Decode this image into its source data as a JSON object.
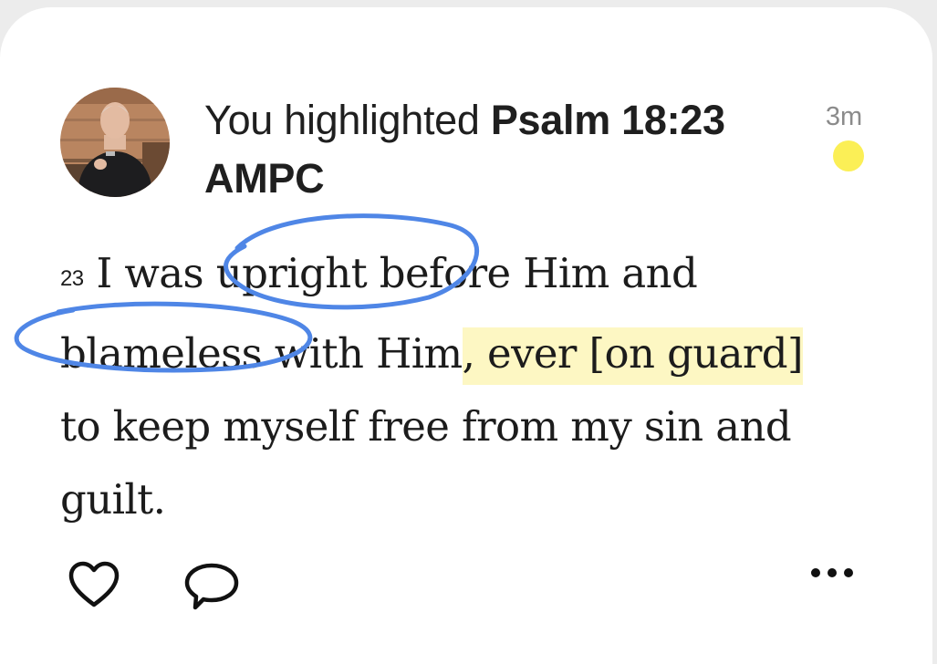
{
  "activity": {
    "prefix": "You highlighted ",
    "reference": "Psalm 18:23 AMPC",
    "time": "3m"
  },
  "avatar": {
    "description_icon": "user-photo-avatar"
  },
  "verse": {
    "number": "23",
    "text_before_highlight": "I was upright before Him and blameless with Him",
    "highlighted_text": ", ever [on guard]",
    "text_after_highlight": " to keep myself free from my sin and guilt."
  },
  "annotations": {
    "circled_words": [
      "upright",
      "blameless"
    ],
    "ink_color": "#4f86e6"
  },
  "colors": {
    "highlight": "#fdf7c3",
    "unread_dot": "#fbef56"
  },
  "actions": {
    "like_icon": "heart-icon",
    "comment_icon": "comment-icon",
    "more_icon": "more-options-icon"
  }
}
